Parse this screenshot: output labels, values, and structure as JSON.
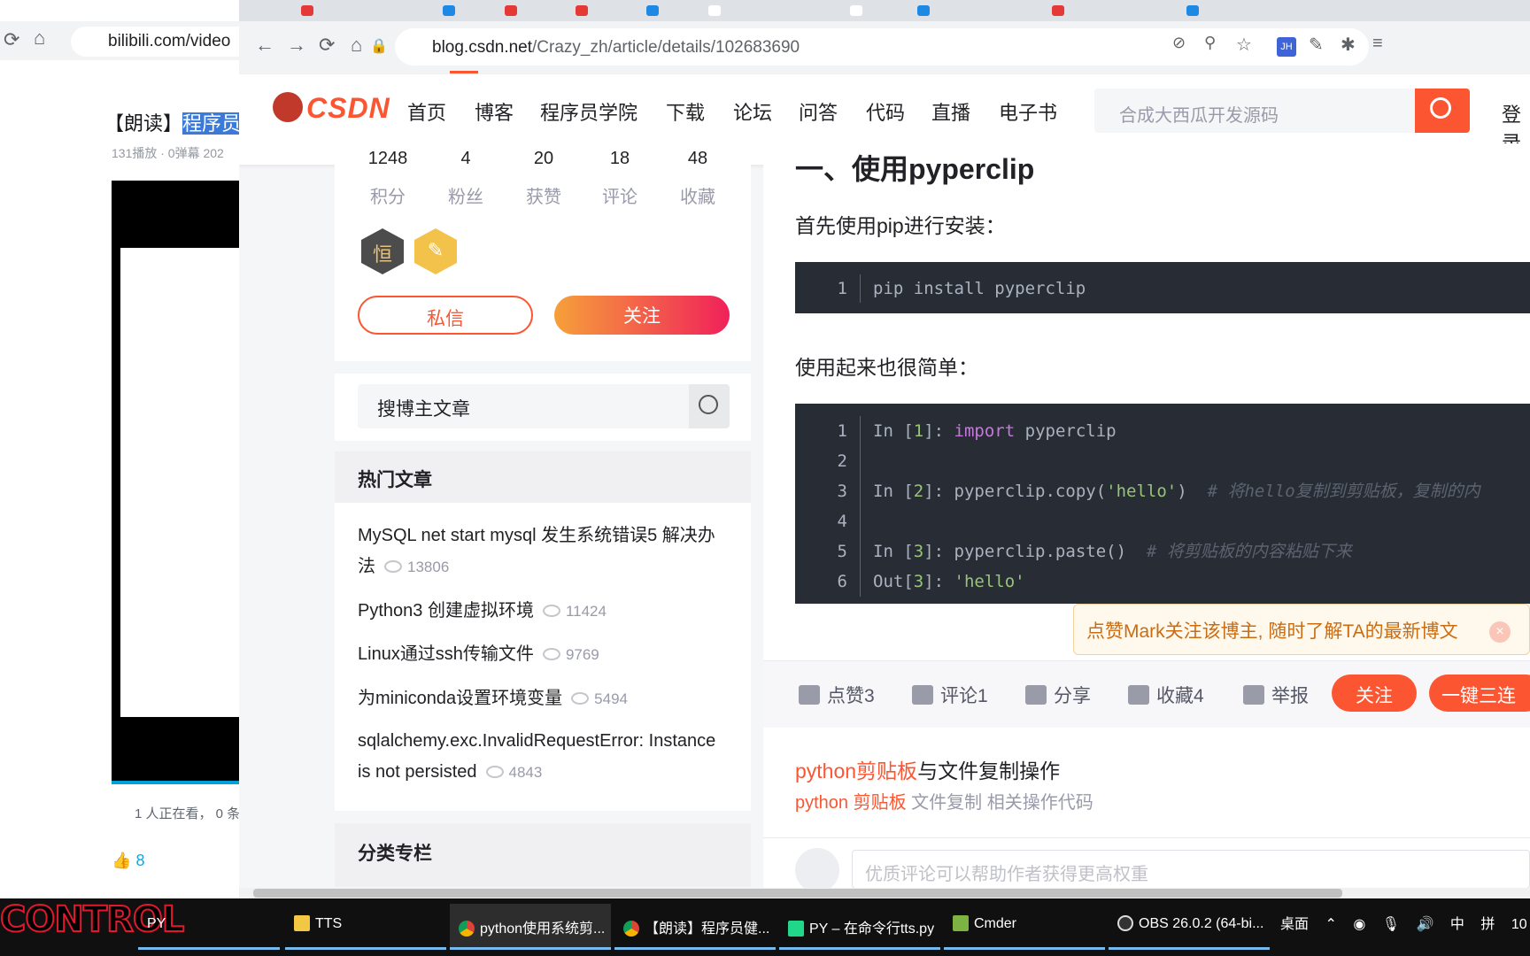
{
  "bili": {
    "url": "bilibili.com/video",
    "title_prefix": "【朗读】",
    "title_highlight": "程序员",
    "meta": "131播放 · 0弹幕   202",
    "watching": "1 人正在看， 0 条",
    "likes": "8"
  },
  "browser": {
    "url_domain": "blog.csdn.net",
    "url_path": "/Crazy_zh/article/details/102683690"
  },
  "csdn": {
    "logo": "CSDN",
    "nav": [
      "首页",
      "博客",
      "程序员学院",
      "下载",
      "论坛",
      "问答",
      "代码",
      "直播",
      "电子书"
    ],
    "search_placeholder": "合成大西瓜开发源码",
    "login": "登录"
  },
  "sidebar": {
    "stats": [
      {
        "value": "1248",
        "label": "积分"
      },
      {
        "value": "4",
        "label": "粉丝"
      },
      {
        "value": "20",
        "label": "获赞"
      },
      {
        "value": "18",
        "label": "评论"
      },
      {
        "value": "48",
        "label": "收藏"
      }
    ],
    "badge1": "恒",
    "badge2": "✎",
    "message_btn": "私信",
    "follow_btn": "关注",
    "search_placeholder": "搜博主文章",
    "hot_title": "热门文章",
    "hot": [
      {
        "title": "MySQL net start mysql 发生系统错误5 解决办法",
        "views": "13806"
      },
      {
        "title": "Python3 创建虚拟环境",
        "views": "11424"
      },
      {
        "title": "Linux通过ssh传输文件",
        "views": "9769"
      },
      {
        "title": "为miniconda设置环境变量",
        "views": "5494"
      },
      {
        "title": "sqlalchemy.exc.InvalidRequestError: Instance is not persisted",
        "views": "4843"
      }
    ],
    "category_title": "分类专栏"
  },
  "article": {
    "heading": "一、使用pyperclip",
    "p1": "首先使用pip进行安装：",
    "code1": "pip install pyperclip",
    "p2": "使用起来也很简单：",
    "code2": {
      "in1_prefix": "In [",
      "n1": "1",
      "in_suffix": "]: ",
      "import_kw": "import",
      "import_mod": " pyperclip",
      "n2": "2",
      "copy_call": "pyperclip.copy(",
      "copy_arg": "'hello'",
      "copy_close": ")",
      "copy_comment": "# 将hello复制到剪贴板，复制的内",
      "n3": "3",
      "paste_call": "pyperclip.paste()",
      "paste_comment": "# 将剪贴板的内容粘贴下来",
      "out_prefix": "Out[",
      "out_val": "'hello'"
    },
    "toast": "点赞Mark关注该博主, 随时了解TA的最新博文",
    "actions": {
      "like": "点赞3",
      "comment": "评论1",
      "share": "分享",
      "fav": "收藏4",
      "report": "举报",
      "follow": "关注",
      "triple": "一键三连"
    },
    "rec_title_red": "python剪贴板",
    "rec_title_rest": "与文件复制操作",
    "rec_desc_red": "python 剪贴板",
    "rec_desc_rest": " 文件复制 相关操作代码",
    "comment_placeholder": "优质评论可以帮助作者获得更高权重"
  },
  "taskbar": {
    "control": "CONTROL",
    "items": [
      "PY",
      "TTS",
      "python使用系统剪...",
      "【朗读】程序员健...",
      "PY – 在命令行tts.py",
      "Cmder",
      "OBS 26.0.2 (64-bi..."
    ],
    "desktop": "桌面",
    "ime": "中",
    "ime2": "拼",
    "clock": "10"
  },
  "colors": {
    "accent": "#fc5531",
    "code_bg": "#282c34",
    "taskbar": "#101010"
  }
}
